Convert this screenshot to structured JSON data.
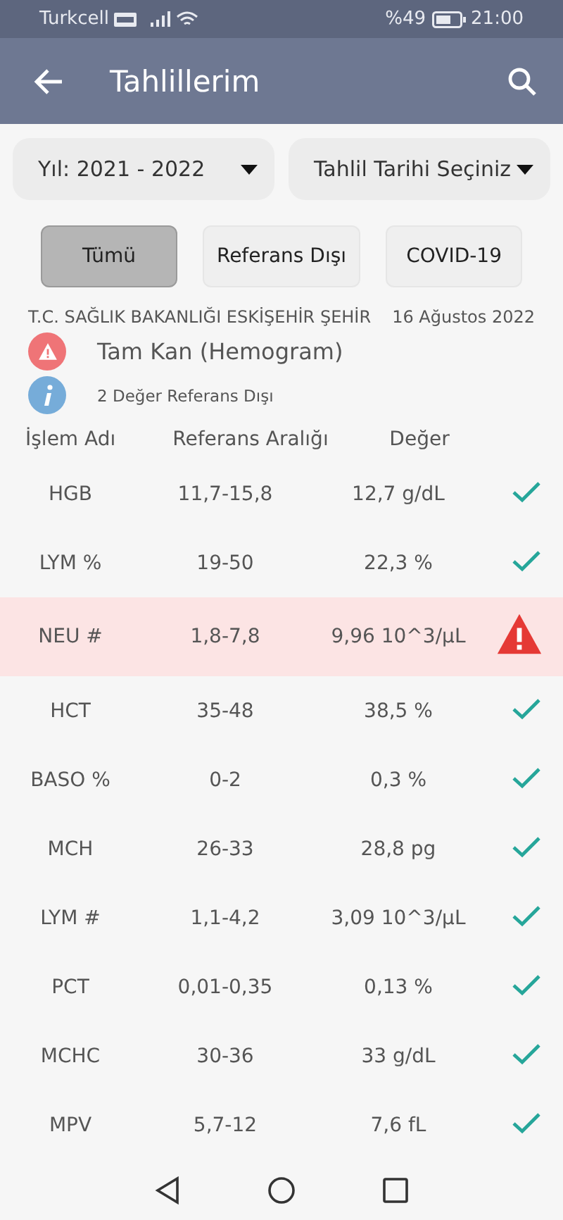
{
  "status_bar": {
    "carrier": "Turkcell",
    "battery": "%49",
    "time": "21:00"
  },
  "app_bar": {
    "title": "Tahlillerim"
  },
  "dropdowns": [
    {
      "value": "Yıl: 2021 - 2022"
    },
    {
      "value": "Tahlil Tarihi Seçiniz"
    }
  ],
  "filters": [
    {
      "label": "Tümü",
      "selected": true
    },
    {
      "label": "Referans Dışı",
      "selected": false
    },
    {
      "label": "COVID-19",
      "selected": false
    }
  ],
  "report": {
    "institution": "T.C. SAĞLIK BAKANLIĞI ESKİŞEHİR ŞEHİR",
    "date": "16 Ağustos 2022",
    "test_name": "Tam Kan (Hemogram)",
    "summary": "2 Değer Referans Dışı"
  },
  "table": {
    "columns": [
      "İşlem Adı",
      "Referans Aralığı",
      "Değer"
    ],
    "rows": [
      {
        "name": "HGB",
        "range": "11,7-15,8",
        "value": "12,7 g/dL",
        "abnormal": false
      },
      {
        "name": "LYM %",
        "range": "19-50",
        "value": "22,3 %",
        "abnormal": false
      },
      {
        "name": "NEU #",
        "range": "1,8-7,8",
        "value": "9,96 10^3/µL",
        "abnormal": true
      },
      {
        "name": "HCT",
        "range": "35-48",
        "value": "38,5 %",
        "abnormal": false
      },
      {
        "name": "BASO %",
        "range": "0-2",
        "value": "0,3 %",
        "abnormal": false
      },
      {
        "name": "MCH",
        "range": "26-33",
        "value": "28,8 pg",
        "abnormal": false
      },
      {
        "name": "LYM #",
        "range": "1,1-4,2",
        "value": "3,09 10^3/µL",
        "abnormal": false
      },
      {
        "name": "PCT",
        "range": "0,01-0,35",
        "value": "0,13 %",
        "abnormal": false
      },
      {
        "name": "MCHC",
        "range": "30-36",
        "value": "33 g/dL",
        "abnormal": false
      },
      {
        "name": "MPV",
        "range": "5,7-12",
        "value": "7,6 fL",
        "abnormal": false
      }
    ]
  }
}
